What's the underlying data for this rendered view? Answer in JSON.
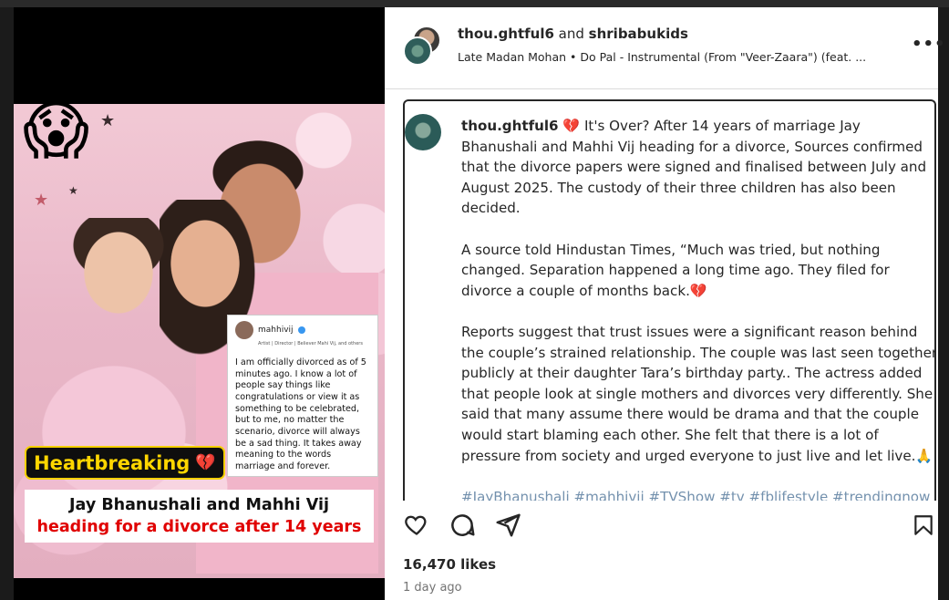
{
  "media": {
    "emoji": "😱",
    "badge_text": "Heartbreaking",
    "badge_emoji": "💔",
    "headline_line1": "Jay Bhanushali and Mahhi Vij",
    "headline_line2": "heading for a divorce after 14 years",
    "quote": {
      "username": "mahhivij",
      "bio": "Artist | Director | Believer Mahi Vij, and others",
      "text": "I am officially divorced as of 5 minutes ago. I know a lot of people say things like congratulations or view it as something to be celebrated, but to me, no matter the scenario, divorce will always be a sad thing. It takes away meaning to the words marriage and forever."
    }
  },
  "header": {
    "user1": "thou.ghtful6",
    "conjunction": " and ",
    "user2": "shribabukids",
    "audio": "Late Madan Mohan • Do Pal - Instrumental (From \"Veer-Zaara\") (feat. ...",
    "more_icon": "more-horizontal-icon"
  },
  "caption": {
    "username": "thou.ghtful6",
    "p1": "💔 It's Over? After 14 years of marriage Jay Bhanushali and Mahhi Vij heading for a divorce, Sources confirmed that the divorce papers were signed and finalised between July and August 2025. The custody of their three children has also been decided.",
    "p2": "A source told Hindustan Times, “Much was tried, but nothing changed. Separation happened a long time ago. They filed for divorce a couple of months back.💔",
    "p3": "Reports suggest that trust issues were a significant reason behind the couple’s strained relationship. The couple was last seen together publicly at their daughter Tara’s birthday party.. The actress added that people look at single mothers and divorces very differently. She said that many assume there would be drama and that the couple would start blaming each other. She felt that there is a lot of pressure from society and urged everyone to just live and let live.🙏",
    "hashtags": "#JayBhanushali #mahhivij #TVShow #tv #fblifestyle #trendingnow"
  },
  "actions": {
    "icons": [
      "heart-icon",
      "comment-icon",
      "share-icon",
      "save-icon"
    ]
  },
  "likes": "16,470 likes",
  "time": "1 day ago"
}
